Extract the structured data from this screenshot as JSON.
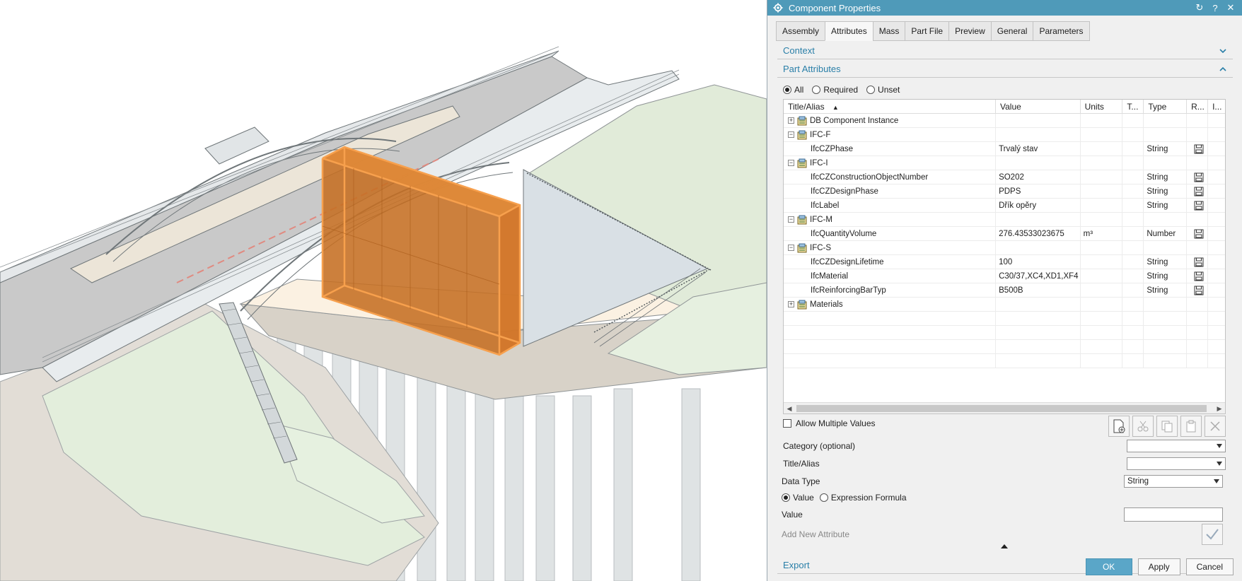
{
  "dialog": {
    "title": "Component Properties",
    "tabs": [
      {
        "label": "Assembly"
      },
      {
        "label": "Attributes"
      },
      {
        "label": "Mass"
      },
      {
        "label": "Part File"
      },
      {
        "label": "Preview"
      },
      {
        "label": "General"
      },
      {
        "label": "Parameters"
      }
    ],
    "active_tab": "Attributes",
    "sections": {
      "context": "Context",
      "part_attributes": "Part Attributes",
      "export": "Export"
    },
    "filter": {
      "all": "All",
      "required": "Required",
      "unset": "Unset",
      "selected": "All"
    },
    "table": {
      "headers": {
        "title": "Title/Alias",
        "value": "Value",
        "units": "Units",
        "t": "T...",
        "type": "Type",
        "r": "R...",
        "i": "I..."
      },
      "rows": [
        {
          "kind": "group",
          "expanded": false,
          "title": "DB Component Instance",
          "value": "",
          "units": "",
          "type": "",
          "saved": false
        },
        {
          "kind": "group",
          "expanded": true,
          "title": "IFC-F",
          "value": "",
          "units": "",
          "type": "",
          "saved": false
        },
        {
          "kind": "attr",
          "title": "IfcCZPhase",
          "value": "Trvalý stav",
          "units": "",
          "type": "String",
          "saved": true
        },
        {
          "kind": "group",
          "expanded": true,
          "title": "IFC-I",
          "value": "",
          "units": "",
          "type": "",
          "saved": false
        },
        {
          "kind": "attr",
          "title": "IfcCZConstructionObjectNumber",
          "value": "SO202",
          "units": "",
          "type": "String",
          "saved": true
        },
        {
          "kind": "attr",
          "title": "IfcCZDesignPhase",
          "value": "PDPS",
          "units": "",
          "type": "String",
          "saved": true
        },
        {
          "kind": "attr",
          "title": "IfcLabel",
          "value": "Dřík opěry",
          "units": "",
          "type": "String",
          "saved": true
        },
        {
          "kind": "group",
          "expanded": true,
          "title": "IFC-M",
          "value": "",
          "units": "",
          "type": "",
          "saved": false
        },
        {
          "kind": "attr",
          "title": "IfcQuantityVolume",
          "value": "276.43533023675",
          "units": "m³",
          "type": "Number",
          "saved": true
        },
        {
          "kind": "group",
          "expanded": true,
          "title": "IFC-S",
          "value": "",
          "units": "",
          "type": "",
          "saved": false
        },
        {
          "kind": "attr",
          "title": "IfcCZDesignLifetime",
          "value": "100",
          "units": "",
          "type": "String",
          "saved": true
        },
        {
          "kind": "attr",
          "title": "IfcMaterial",
          "value": "C30/37,XC4,XD1,XF4",
          "units": "",
          "type": "String",
          "saved": true
        },
        {
          "kind": "attr",
          "title": "IfcReinforcingBarTyp",
          "value": "B500B",
          "units": "",
          "type": "String",
          "saved": true
        },
        {
          "kind": "group",
          "expanded": false,
          "title": "Materials",
          "value": "",
          "units": "",
          "type": "",
          "saved": false
        }
      ]
    },
    "allow_multiple_values": "Allow Multiple Values",
    "form": {
      "category_label": "Category (optional)",
      "category_value": "",
      "title_label": "Title/Alias",
      "title_value": "",
      "data_type_label": "Data Type",
      "data_type_value": "String",
      "value_mode_value": "Value",
      "value_mode_formula": "Expression Formula",
      "value_label": "Value",
      "value_value": "",
      "add_new_attribute": "Add New Attribute"
    },
    "buttons": {
      "ok": "OK",
      "apply": "Apply",
      "cancel": "Cancel"
    },
    "colors": {
      "accent": "#4f9ab9",
      "section_text": "#2a7fa8",
      "selection_orange": "#f0963a"
    }
  }
}
